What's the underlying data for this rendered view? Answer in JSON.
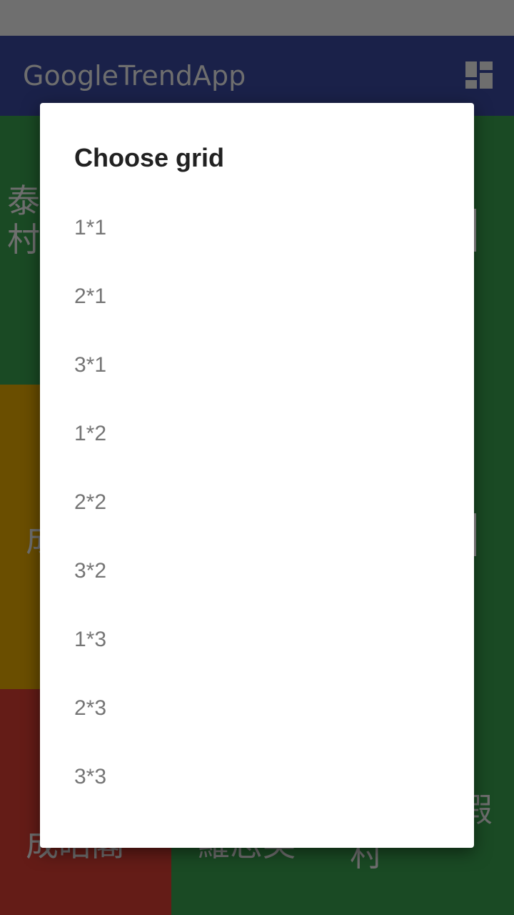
{
  "app": {
    "title": "GoogleTrendApp"
  },
  "icons": {
    "grid": "dashboard-grid-icon"
  },
  "colors": {
    "status_bar": "#6f6f6f",
    "app_bar": "#1a2149",
    "tile_green": "#1a4a24",
    "tile_yellow": "#6a4e00",
    "tile_red": "#641c17",
    "dialog_bg": "#ffffff"
  },
  "tiles": [
    {
      "text": "泰\n村"
    },
    {
      "text": "成"
    },
    {
      "text": "成皓閣"
    },
    {
      "text": "羅志英"
    },
    {
      "text": "村"
    },
    {
      "text": "假"
    }
  ],
  "dialog": {
    "title": "Choose grid",
    "options": [
      "1*1",
      "2*1",
      "3*1",
      "1*2",
      "2*2",
      "3*2",
      "1*3",
      "2*3",
      "3*3"
    ]
  }
}
